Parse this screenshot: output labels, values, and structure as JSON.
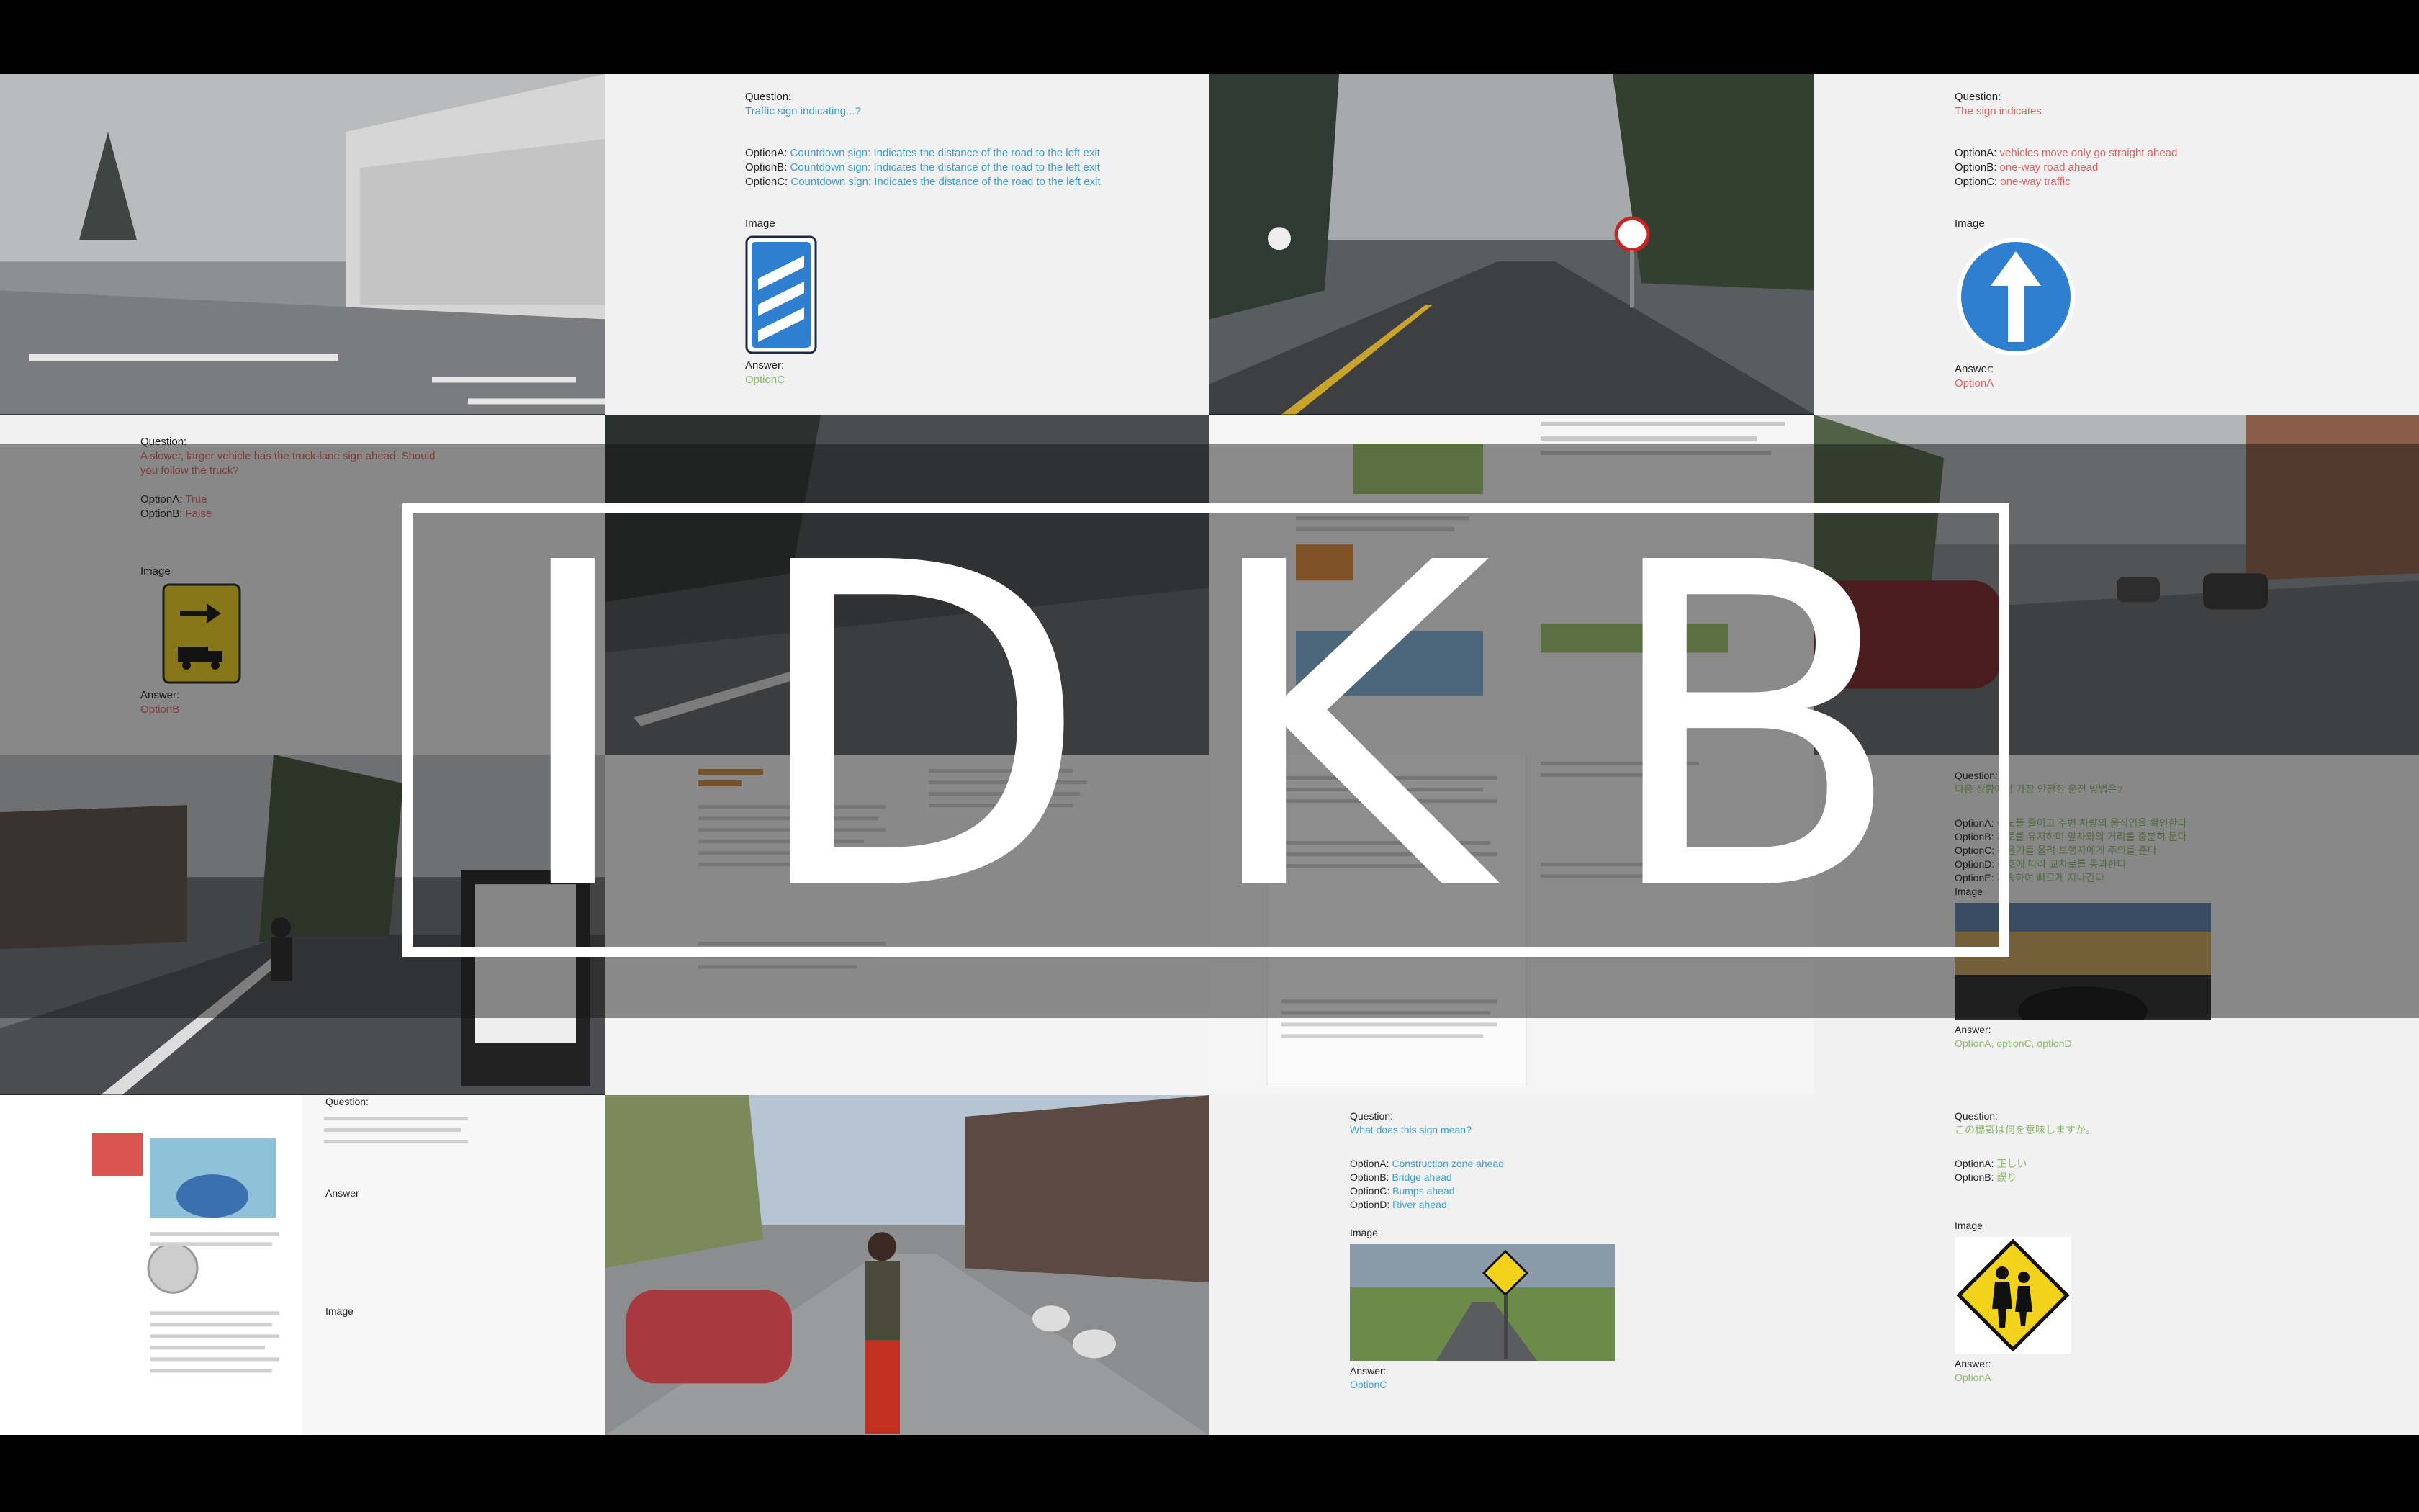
{
  "title": "IDKB",
  "qa": {
    "q1": {
      "question_label": "Question:",
      "question": "Traffic sign indicating...?",
      "options": [
        {
          "label": "OptionA:",
          "text": "Countdown sign: Indicates the distance of the road to the left exit"
        },
        {
          "label": "OptionB:",
          "text": "Countdown sign: Indicates the distance of the road to the left exit"
        },
        {
          "label": "OptionC:",
          "text": "Countdown sign: Indicates the distance of the road to the left exit"
        }
      ],
      "image_label": "Image",
      "answer_label": "Answer:",
      "answer": "OptionC"
    },
    "q2": {
      "question_label": "Question:",
      "question": "The sign indicates",
      "options": [
        {
          "label": "OptionA:",
          "text": "vehicles move only go straight ahead"
        },
        {
          "label": "OptionB:",
          "text": "one-way road ahead"
        },
        {
          "label": "OptionC:",
          "text": "one-way traffic"
        }
      ],
      "image_label": "Image",
      "answer_label": "Answer:",
      "answer": "OptionA"
    },
    "q3": {
      "question_label": "Question:",
      "question": "A slower, larger vehicle has the truck-lane sign ahead. Should you follow the truck?",
      "options": [
        {
          "label": "OptionA:",
          "text": "True"
        },
        {
          "label": "OptionB:",
          "text": "False"
        }
      ],
      "image_label": "Image",
      "answer_label": "Answer:",
      "answer": "OptionB"
    },
    "q4": {
      "question_label": "Question:",
      "question": "What does this sign mean?",
      "options": [
        {
          "label": "OptionA:",
          "text": "Construction zone ahead"
        },
        {
          "label": "OptionB:",
          "text": "Bridge ahead"
        },
        {
          "label": "OptionC:",
          "text": "Bumps ahead"
        },
        {
          "label": "OptionD:",
          "text": "River ahead"
        }
      ],
      "image_label": "Image",
      "answer_label": "Answer:",
      "answer": "OptionC"
    },
    "q5": {
      "question_label": "Question:",
      "question": "この標識は何を意味しますか。",
      "options": [
        {
          "label": "OptionA:",
          "text": "正しい"
        },
        {
          "label": "OptionB:",
          "text": "誤り"
        }
      ],
      "image_label": "Image",
      "answer_label": "Answer:",
      "answer": "OptionA"
    },
    "q6": {
      "question_label": "Question:",
      "question": "다음 상황에서 가장 안전한 운전 방법은?",
      "options": [
        {
          "label": "OptionA:",
          "text": "속도를 줄이고 주변 차량의 움직임을 확인한다"
        },
        {
          "label": "OptionB:",
          "text": "차로를 유지하며 앞차와의 거리를 충분히 둔다"
        },
        {
          "label": "OptionC:",
          "text": "경음기를 울려 보행자에게 주의를 준다"
        },
        {
          "label": "OptionD:",
          "text": "신호에 따라 교차로를 통과한다"
        },
        {
          "label": "OptionE:",
          "text": "가속하여 빠르게 지나간다"
        }
      ],
      "image_label": "Image",
      "answer_label": "Answer:",
      "answer": "OptionA, optionC, optionD"
    },
    "q7": {
      "question_label": "Question:",
      "answer_label": "Answer",
      "image_label": "Image"
    }
  },
  "colors": {
    "qa_background": "#f1f1f1",
    "overlay": "rgba(20,20,20,0.48)",
    "title": "#ffffff",
    "sign_blue": "#2f7fd1",
    "sign_yellow": "#f2d21b"
  }
}
